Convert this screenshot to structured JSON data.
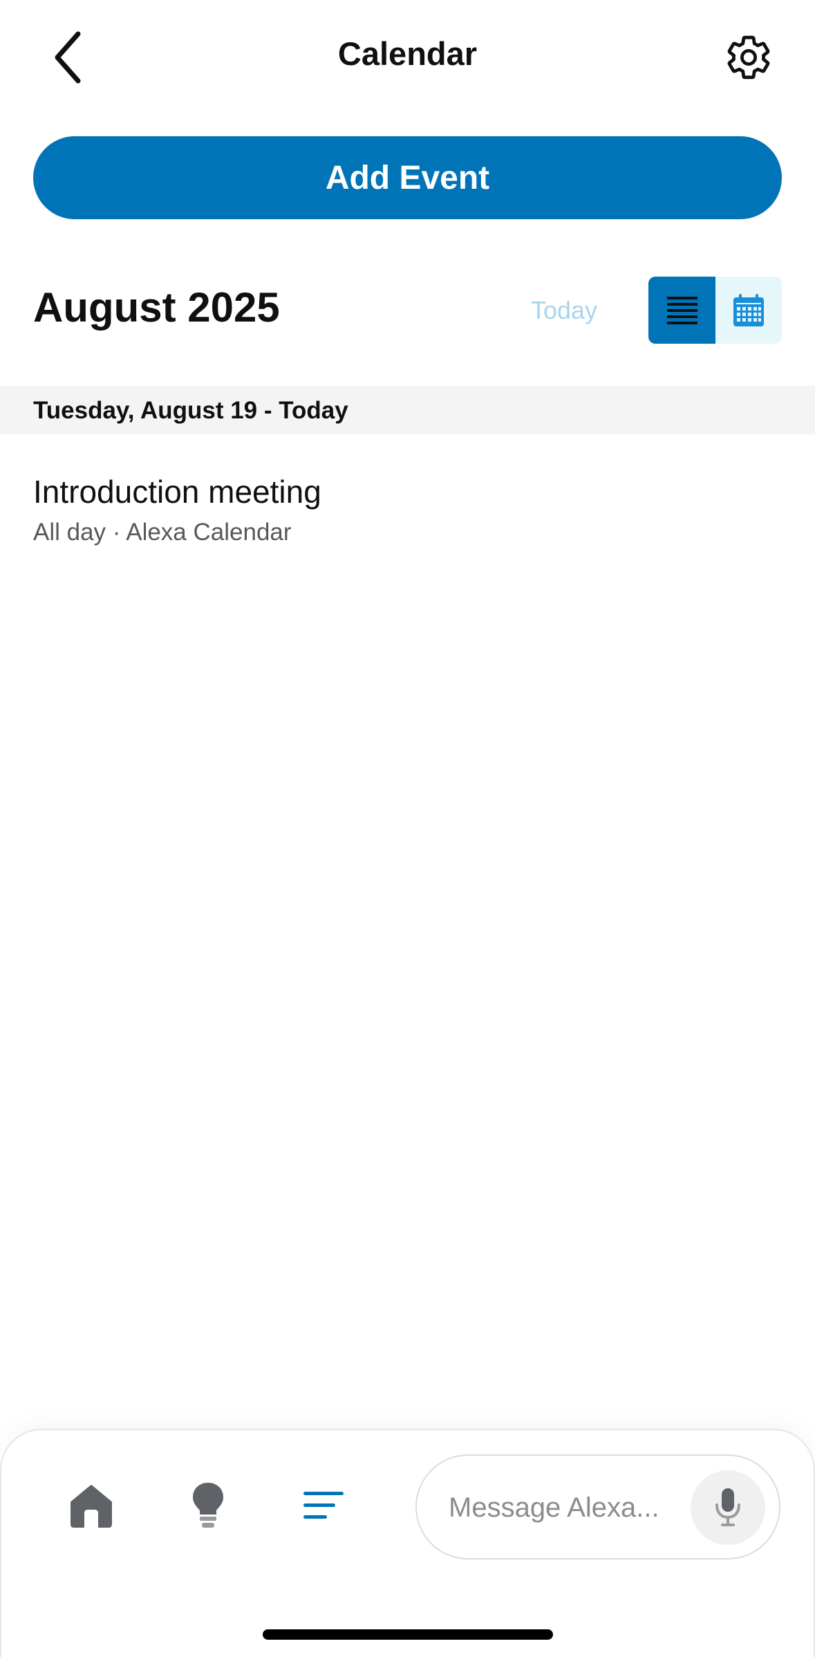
{
  "header": {
    "title": "Calendar"
  },
  "actions": {
    "add_event_label": "Add Event"
  },
  "calendar": {
    "month_title": "August 2025",
    "today_label": "Today",
    "view_modes": [
      "list",
      "calendar"
    ],
    "active_view": "list"
  },
  "agenda": {
    "day_header": "Tuesday, August 19 - Today",
    "events": [
      {
        "title": "Introduction meeting",
        "subtitle": "All day · Alexa Calendar"
      }
    ]
  },
  "bottom_nav": {
    "items": [
      {
        "icon": "home-icon"
      },
      {
        "icon": "lightbulb-icon"
      },
      {
        "icon": "menu-lines-icon",
        "active": true
      }
    ],
    "message_placeholder": "Message Alexa..."
  },
  "colors": {
    "primary": "#0174b8",
    "today_link": "#a9d4ee",
    "calendar_toggle_bg": "#e6f7fc",
    "day_header_bg": "#f4f4f4",
    "icon_gray": "#5f6368"
  }
}
